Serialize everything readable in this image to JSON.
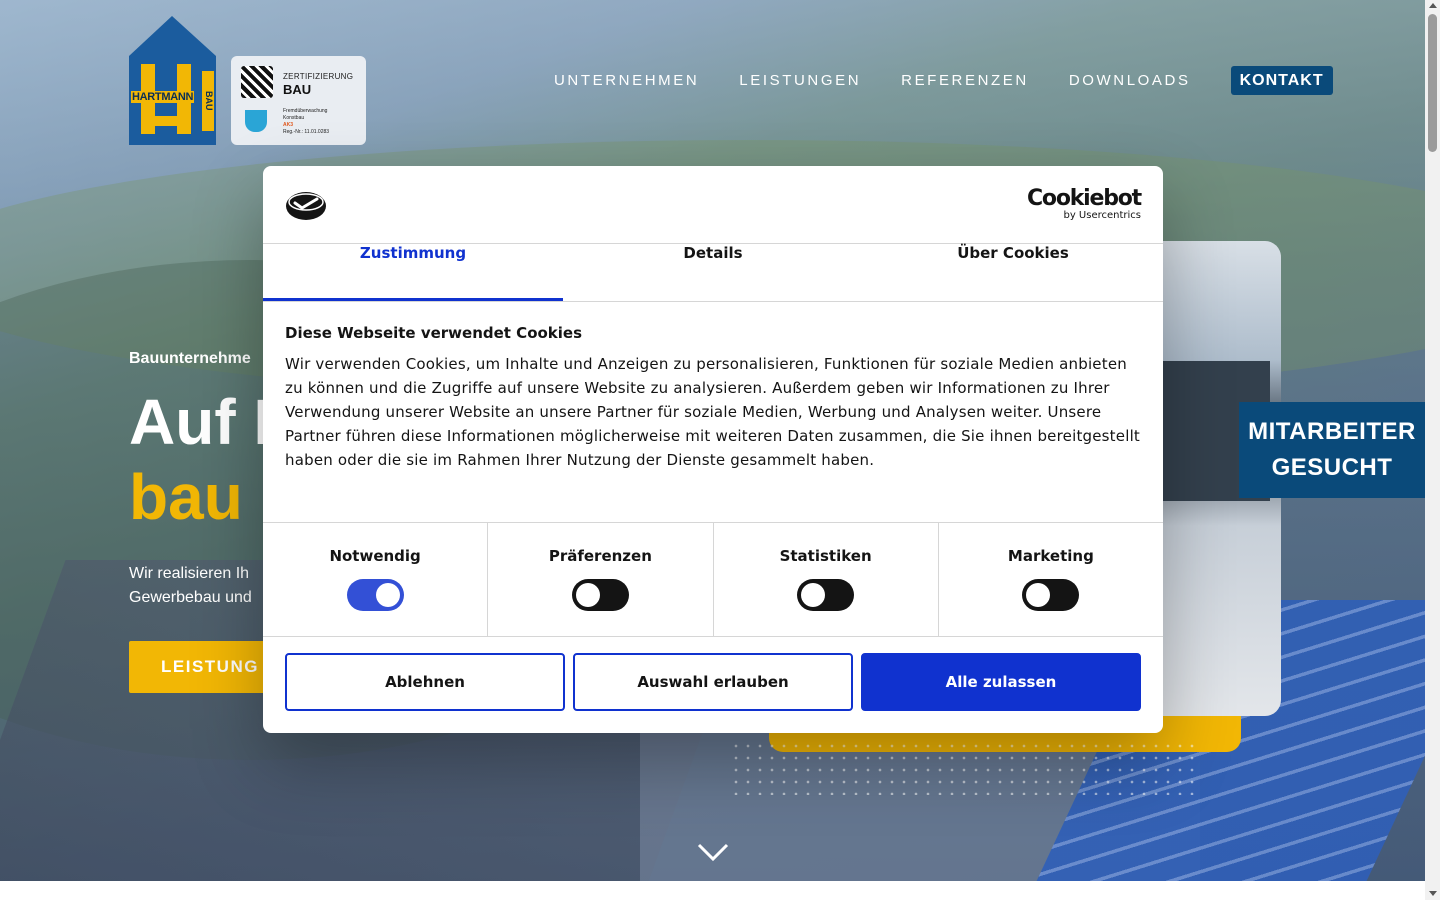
{
  "header": {
    "logo_name": "HARTMANN",
    "logo_side": "BAU",
    "cert_label": "ZERTIFIZIERUNG",
    "cert_title": "BAU",
    "cert_line1": "Fremdüberwachung",
    "cert_line2": "Konstbau",
    "cert_line3": "AK3",
    "cert_line4": "Reg.-Nr.: 11.01.0283"
  },
  "nav": {
    "items": [
      "UNTERNEHMEN",
      "LEISTUNGEN",
      "REFERENZEN",
      "DOWNLOADS"
    ],
    "contact": "KONTAKT"
  },
  "hero": {
    "subtitle": "Bauunternehme",
    "title_line1": "Auf I",
    "title_line2": "bau",
    "text": "Wir realisieren Ih Gewerbebau und",
    "button": "LEISTUNG"
  },
  "jobs": {
    "line1": "MITARBEITER",
    "line2": "GESUCHT"
  },
  "cookie": {
    "brand": "Cookiebot",
    "brand_sub": "by Usercentrics",
    "tabs": [
      "Zustimmung",
      "Details",
      "Über Cookies"
    ],
    "heading": "Diese Webseite verwendet Cookies",
    "text": "Wir verwenden Cookies, um Inhalte und Anzeigen zu personalisieren, Funktionen für soziale Medien anbieten zu können und die Zugriffe auf unsere Website zu analysieren. Außerdem geben wir Informationen zu Ihrer Verwendung unserer Website an unsere Partner für soziale Medien, Werbung und Analysen weiter. Unsere Partner führen diese Informationen möglicherweise mit weiteren Daten zusammen, die Sie ihnen bereitgestellt haben oder die sie im Rahmen Ihrer Nutzung der Dienste gesammelt haben.",
    "categories": [
      {
        "label": "Notwendig",
        "on": true
      },
      {
        "label": "Präferenzen",
        "on": false
      },
      {
        "label": "Statistiken",
        "on": false
      },
      {
        "label": "Marketing",
        "on": false
      }
    ],
    "buttons": {
      "decline": "Ablehnen",
      "allow_selection": "Auswahl erlauben",
      "allow_all": "Alle zulassen"
    }
  },
  "colors": {
    "brand_blue": "#0a4a7a",
    "brand_yellow": "#f2b705",
    "cookiebot_blue": "#1032cf"
  }
}
